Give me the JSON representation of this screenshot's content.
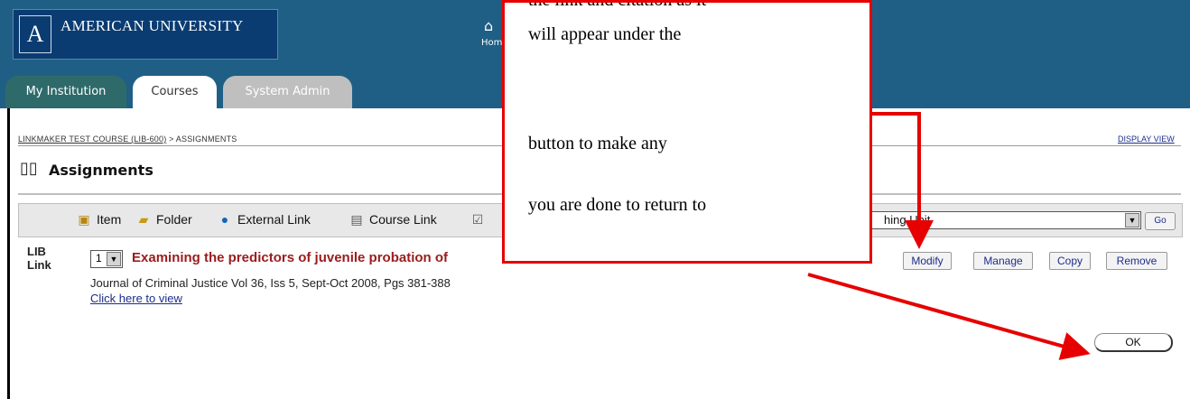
{
  "header": {
    "logo_text": "AMERICAN UNIVERSITY",
    "home_label": "Hom",
    "tabs": [
      {
        "label": "My Institution"
      },
      {
        "label": "Courses"
      },
      {
        "label": "System Admin"
      }
    ]
  },
  "breadcrumb": {
    "course_link": "LINKMAKER TEST COURSE (LIB-600)",
    "separator": " > ",
    "current": "ASSIGNMENTS"
  },
  "display_view": "DISPLAY VIEW",
  "page_title": "Assignments",
  "toolbar": {
    "items": [
      {
        "label": "Item",
        "icon": "item-icon"
      },
      {
        "label": "Folder",
        "icon": "folder-icon"
      },
      {
        "label": "External Link",
        "icon": "globe-icon"
      },
      {
        "label": "Course Link",
        "icon": "course-link-icon"
      }
    ],
    "select_value": "hing Unit",
    "go_label": "Go"
  },
  "content_item": {
    "order": "1",
    "title": "Examining the predictors of juvenile probation of",
    "citation": "Journal of Criminal Justice Vol 36, Iss 5, Sept-Oct 2008, Pgs 381-388",
    "link": "Click here to view",
    "icon_text_top": "LIB",
    "icon_text_bottom": "Link",
    "actions": {
      "modify": "Modify",
      "manage": "Manage",
      "copy": "Copy",
      "remove": "Remove"
    }
  },
  "ok_label": "OK",
  "callout": {
    "line1": "the link and citation as it",
    "line2": "will appear under the",
    "line3": "button to make any",
    "line4": "you are done to return to"
  },
  "colors": {
    "header_bg": "#1f5f85",
    "callout_border": "#e60000",
    "arrow": "#e60000",
    "title_red": "#9b1c1c",
    "link_blue": "#1c2d8c"
  }
}
